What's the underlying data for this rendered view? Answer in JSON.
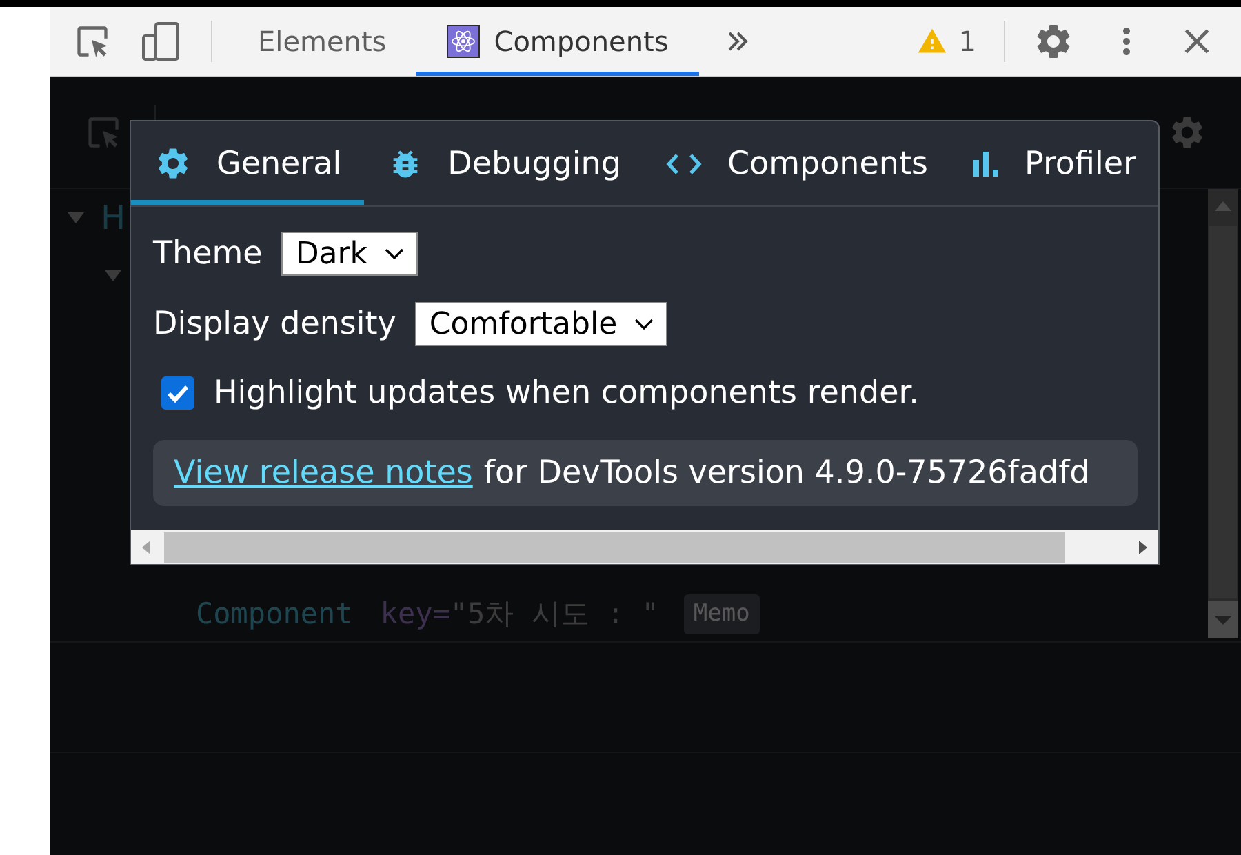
{
  "toolbar": {
    "tabs": [
      {
        "label": "Elements",
        "kind": "plain",
        "selected": false
      },
      {
        "label": "Components",
        "kind": "react",
        "selected": true
      }
    ],
    "warning_count": "1"
  },
  "tree": [
    {
      "label": "H",
      "expanded": true,
      "children": [
        {
          "expanded": true,
          "children": [
            {
              "name": "Component",
              "attribute": "key=",
              "value": "\"5차 시도 : \"",
              "badge": "Memo"
            }
          ]
        }
      ]
    }
  ],
  "settings": {
    "tabs": [
      {
        "label": "General",
        "kind": "gear",
        "selected": true
      },
      {
        "label": "Debugging",
        "kind": "bug",
        "selected": false
      },
      {
        "label": "Components",
        "kind": "code",
        "selected": false
      },
      {
        "label": "Profiler",
        "kind": "chart",
        "selected": false
      }
    ],
    "fields": [
      {
        "label": "Theme",
        "value": "Dark"
      },
      {
        "label": "Display density",
        "value": "Comfortable"
      }
    ],
    "highlight": {
      "label": "Highlight updates when components render.",
      "checked": true
    },
    "release": {
      "link": "View release notes",
      "text": "for DevTools version 4.9.0-75726fadfd"
    }
  }
}
